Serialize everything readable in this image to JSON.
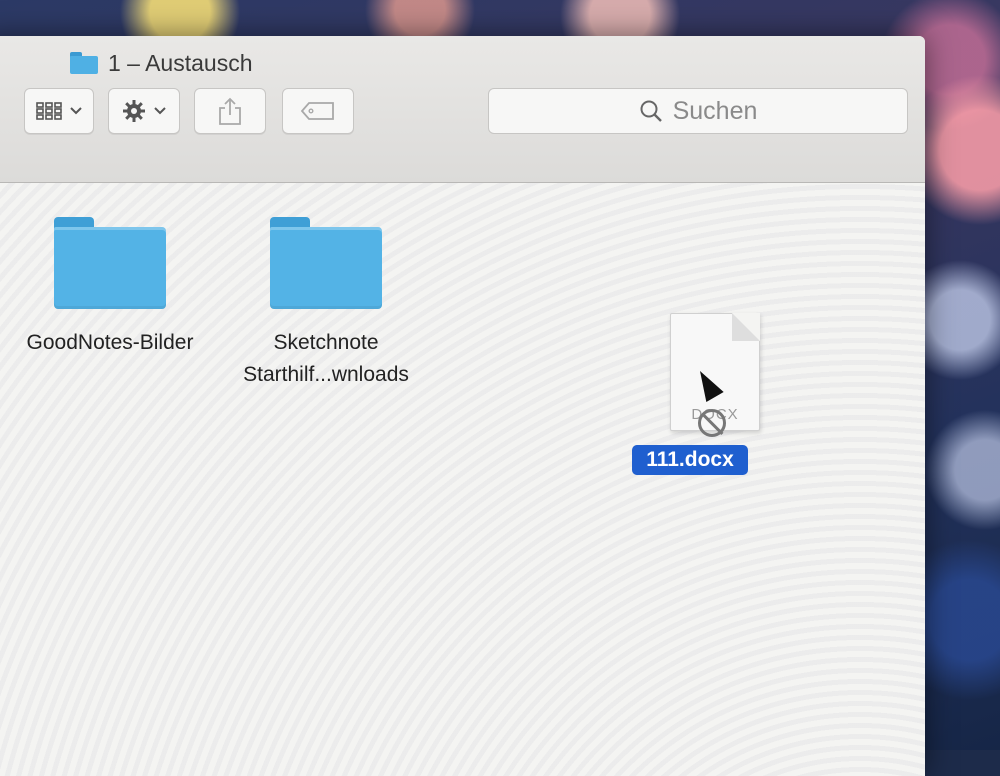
{
  "window": {
    "title": "1 – Austausch"
  },
  "toolbar": {
    "view_icon": "grid-view-icon",
    "action_icon": "gear-icon",
    "share_icon": "share-icon",
    "tag_icon": "tag-icon"
  },
  "search": {
    "placeholder": "Suchen"
  },
  "items": [
    {
      "name": "GoodNotes-Bilder",
      "kind": "folder"
    },
    {
      "name_line1": "Sketchnote",
      "name_line2": "Starthilf...wnloads",
      "kind": "folder"
    },
    {
      "name": "111.docx",
      "kind": "document",
      "extension": "DOCX",
      "selected": true
    }
  ],
  "colors": {
    "folder": "#53b3e6",
    "selection": "#1f5fcf"
  }
}
